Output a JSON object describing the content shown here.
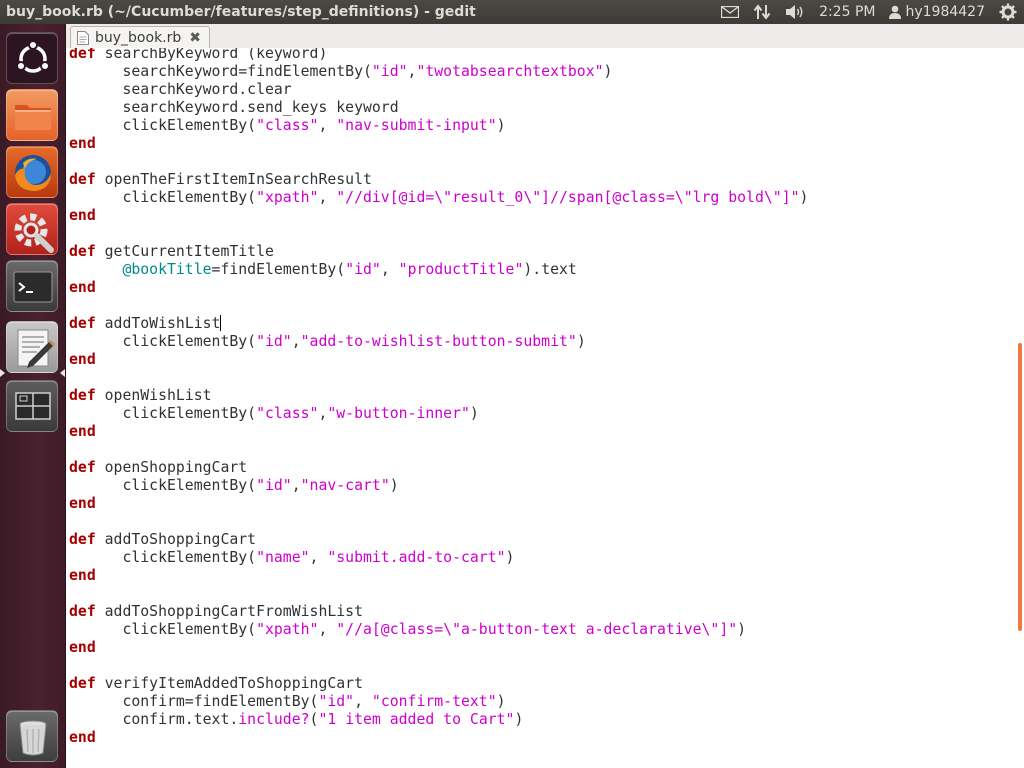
{
  "window": {
    "title": "buy_book.rb (~/Cucumber/features/step_definitions) - gedit"
  },
  "panel": {
    "mail_icon": "envelope-icon",
    "network_icon": "network-arrows-icon",
    "sound_icon": "speaker-icon",
    "clock": "2:25 PM",
    "user": "hy1984427",
    "power_icon": "gear-power-icon"
  },
  "launcher": {
    "items": [
      {
        "name": "dash-home",
        "icon": "ubuntu-logo-icon"
      },
      {
        "name": "files",
        "icon": "folder-icon"
      },
      {
        "name": "firefox",
        "icon": "firefox-icon"
      },
      {
        "name": "system-settings",
        "icon": "settings-wrench-icon"
      },
      {
        "name": "terminal",
        "icon": "terminal-icon"
      },
      {
        "name": "gedit",
        "icon": "text-editor-icon",
        "active": true
      },
      {
        "name": "workspace-switcher",
        "icon": "workspaces-icon"
      },
      {
        "name": "trash",
        "icon": "trash-icon"
      }
    ]
  },
  "tab": {
    "label": "buy_book.rb",
    "close": "✖"
  },
  "editor": {
    "cursor_line": 15,
    "lines": [
      [
        [
          "kw",
          "def"
        ],
        [
          "p",
          " searchByKeyword (keyword)"
        ]
      ],
      [
        [
          "p",
          "      searchKeyword=findElementBy("
        ],
        [
          "str",
          "\"id\""
        ],
        [
          "p",
          ","
        ],
        [
          "str",
          "\"twotabsearchtextbox\""
        ],
        [
          "p",
          ")"
        ]
      ],
      [
        [
          "p",
          "      searchKeyword.clear"
        ]
      ],
      [
        [
          "p",
          "      searchKeyword.send_keys keyword"
        ]
      ],
      [
        [
          "p",
          "      clickElementBy("
        ],
        [
          "str",
          "\"class\""
        ],
        [
          "p",
          ", "
        ],
        [
          "str",
          "\"nav-submit-input\""
        ],
        [
          "p",
          ")"
        ]
      ],
      [
        [
          "kw",
          "end"
        ]
      ],
      [],
      [
        [
          "kw",
          "def"
        ],
        [
          "p",
          " openTheFirstItemInSearchResult"
        ]
      ],
      [
        [
          "p",
          "      clickElementBy("
        ],
        [
          "str",
          "\"xpath\""
        ],
        [
          "p",
          ", "
        ],
        [
          "str",
          "\"//div[@id=\\\"result_0\\\"]//span[@class=\\\"lrg bold\\\"]\""
        ],
        [
          "p",
          ")"
        ]
      ],
      [
        [
          "kw",
          "end"
        ]
      ],
      [],
      [
        [
          "kw",
          "def"
        ],
        [
          "p",
          " getCurrentItemTitle"
        ]
      ],
      [
        [
          "ivar",
          "      @bookTitle"
        ],
        [
          "p",
          "=findElementBy("
        ],
        [
          "str",
          "\"id\""
        ],
        [
          "p",
          ", "
        ],
        [
          "str",
          "\"productTitle\""
        ],
        [
          "p",
          ").text"
        ]
      ],
      [
        [
          "kw",
          "end"
        ]
      ],
      [],
      [
        [
          "kw",
          "def"
        ],
        [
          "p",
          " addToWishList"
        ]
      ],
      [
        [
          "p",
          "      clickElementBy("
        ],
        [
          "str",
          "\"id\""
        ],
        [
          "p",
          ","
        ],
        [
          "str",
          "\"add-to-wishlist-button-submit\""
        ],
        [
          "p",
          ")"
        ]
      ],
      [
        [
          "kw",
          "end"
        ]
      ],
      [],
      [
        [
          "kw",
          "def"
        ],
        [
          "p",
          " openWishList"
        ]
      ],
      [
        [
          "p",
          "      clickElementBy("
        ],
        [
          "str",
          "\"class\""
        ],
        [
          "p",
          ","
        ],
        [
          "str",
          "\"w-button-inner\""
        ],
        [
          "p",
          ")"
        ]
      ],
      [
        [
          "kw",
          "end"
        ]
      ],
      [],
      [
        [
          "kw",
          "def"
        ],
        [
          "p",
          " openShoppingCart"
        ]
      ],
      [
        [
          "p",
          "      clickElementBy("
        ],
        [
          "str",
          "\"id\""
        ],
        [
          "p",
          ","
        ],
        [
          "str",
          "\"nav-cart\""
        ],
        [
          "p",
          ")"
        ]
      ],
      [
        [
          "kw",
          "end"
        ]
      ],
      [],
      [
        [
          "kw",
          "def"
        ],
        [
          "p",
          " addToShoppingCart"
        ]
      ],
      [
        [
          "p",
          "      clickElementBy("
        ],
        [
          "str",
          "\"name\""
        ],
        [
          "p",
          ", "
        ],
        [
          "str",
          "\"submit.add-to-cart\""
        ],
        [
          "p",
          ")"
        ]
      ],
      [
        [
          "kw",
          "end"
        ]
      ],
      [],
      [
        [
          "kw",
          "def"
        ],
        [
          "p",
          " addToShoppingCartFromWishList"
        ]
      ],
      [
        [
          "p",
          "      clickElementBy("
        ],
        [
          "str",
          "\"xpath\""
        ],
        [
          "p",
          ", "
        ],
        [
          "str",
          "\"//a[@class=\\\"a-button-text a-declarative\\\"]\""
        ],
        [
          "p",
          ")"
        ]
      ],
      [
        [
          "kw",
          "end"
        ]
      ],
      [],
      [
        [
          "kw",
          "def"
        ],
        [
          "p",
          " verifyItemAddedToShoppingCart"
        ]
      ],
      [
        [
          "p",
          "      confirm=findElementBy("
        ],
        [
          "str",
          "\"id\""
        ],
        [
          "p",
          ", "
        ],
        [
          "str",
          "\"confirm-text\""
        ],
        [
          "p",
          ")"
        ]
      ],
      [
        [
          "p",
          "      confirm.text."
        ],
        [
          "str",
          "include?"
        ],
        [
          "p",
          "("
        ],
        [
          "str",
          "\"1 item added to Cart\""
        ],
        [
          "p",
          ")"
        ]
      ],
      [
        [
          "kw",
          "end"
        ]
      ]
    ]
  },
  "scrollbar": {
    "visible_start_fraction": 0.41,
    "visible_end_fraction": 0.81
  },
  "colors": {
    "keyword": "#a40000",
    "string": "#ce00ce",
    "instance_var": "#008a8a",
    "scroll_thumb": "#f07746"
  }
}
